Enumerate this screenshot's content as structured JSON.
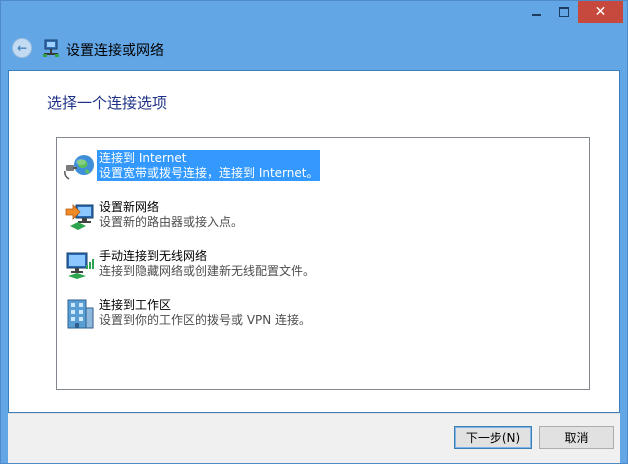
{
  "window": {
    "title": "设置连接或网络",
    "controls": {
      "minimize": "minimize",
      "maximize": "maximize",
      "close": "✕"
    }
  },
  "main": {
    "heading": "选择一个连接选项",
    "options": [
      {
        "title": "连接到 Internet",
        "desc": "设置宽带或拨号连接，连接到 Internet。",
        "icon": "globe-network-icon",
        "selected": true
      },
      {
        "title": "设置新网络",
        "desc": "设置新的路由器或接入点。",
        "icon": "new-network-icon",
        "selected": false
      },
      {
        "title": "手动连接到无线网络",
        "desc": "连接到隐藏网络或创建新无线配置文件。",
        "icon": "wireless-network-icon",
        "selected": false
      },
      {
        "title": "连接到工作区",
        "desc": "设置到你的工作区的拨号或 VPN 连接。",
        "icon": "workplace-icon",
        "selected": false
      }
    ]
  },
  "footer": {
    "next_label": "下一步(N)",
    "cancel_label": "取消"
  },
  "colors": {
    "frame": "#62a6e6",
    "close": "#c7483d",
    "selection": "#3399ff",
    "heading": "#1e3287"
  }
}
